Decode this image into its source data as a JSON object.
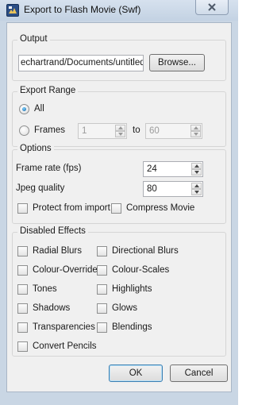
{
  "window": {
    "title": "Export to Flash Movie (Swf)",
    "app_icon": "flash-export-icon",
    "close_icon": "close-icon"
  },
  "output": {
    "group_title": "Output",
    "path_value": "echartrand/Documents/untitled.swf",
    "browse_label": "Browse..."
  },
  "export_range": {
    "group_title": "Export Range",
    "all_label": "All",
    "all_selected": true,
    "frames_label": "Frames",
    "frames_selected": false,
    "from_value": "1",
    "to_label": "to",
    "to_value": "60"
  },
  "options": {
    "group_title": "Options",
    "frame_rate_label": "Frame rate (fps)",
    "frame_rate_value": "24",
    "jpeg_quality_label": "Jpeg quality",
    "jpeg_quality_value": "80",
    "protect_label": "Protect from import",
    "protect_checked": false,
    "compress_label": "Compress Movie",
    "compress_checked": false
  },
  "disabled_effects": {
    "group_title": "Disabled Effects",
    "items": [
      {
        "label": "Radial Blurs",
        "checked": false
      },
      {
        "label": "Directional Blurs",
        "checked": false
      },
      {
        "label": "Colour-Overrides",
        "checked": false
      },
      {
        "label": "Colour-Scales",
        "checked": false
      },
      {
        "label": "Tones",
        "checked": false
      },
      {
        "label": "Highlights",
        "checked": false
      },
      {
        "label": "Shadows",
        "checked": false
      },
      {
        "label": "Glows",
        "checked": false
      },
      {
        "label": "Transparencies",
        "checked": false
      },
      {
        "label": "Blendings",
        "checked": false
      },
      {
        "label": "Convert Pencils",
        "checked": false
      }
    ]
  },
  "footer": {
    "ok_label": "OK",
    "cancel_label": "Cancel"
  }
}
